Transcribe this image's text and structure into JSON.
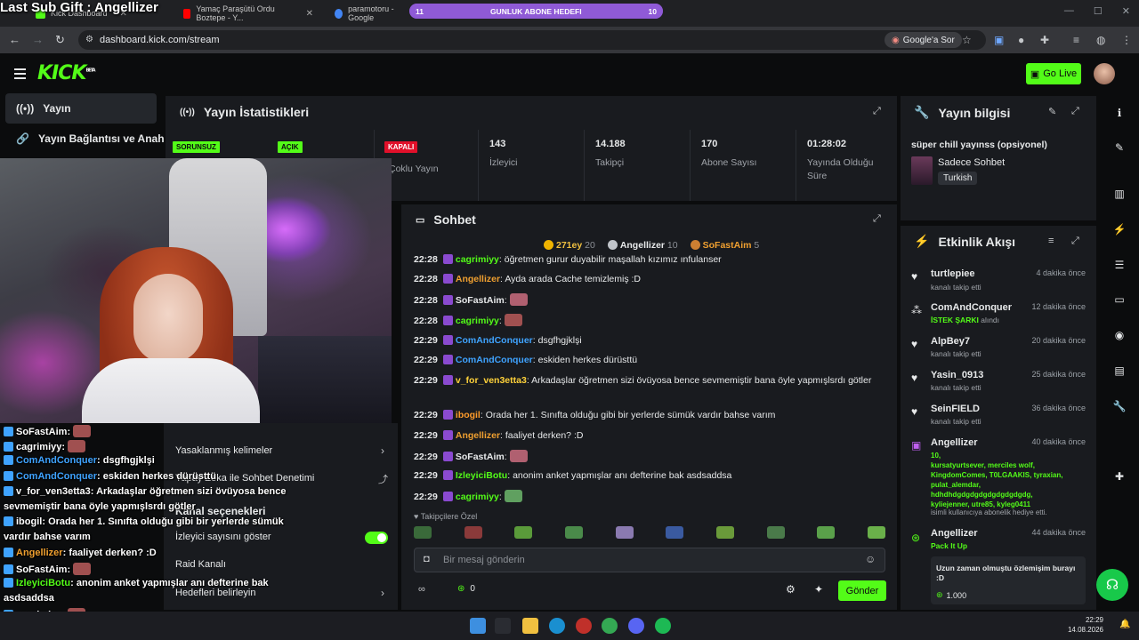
{
  "overlay_title": "Last Sub Gift : Angellizer",
  "browser": {
    "tabs": [
      {
        "label": "Kick Dashboard"
      },
      {
        "label": "Yamaç Paraşütü Ordu Boztepe - Y..."
      },
      {
        "label": "paramotoru - Google"
      }
    ],
    "url": "dashboard.kick.com/stream",
    "google_pill": "Google'a Sor"
  },
  "goal": {
    "start": "11",
    "label": "GUNLUK ABONE HEDEFI",
    "end": "10",
    "progress": 1.0
  },
  "header": {
    "logo": "KICK",
    "logo_beta": "BETA",
    "golive_label": "Go Live"
  },
  "sidebar": {
    "items": [
      {
        "label": "Yayın"
      },
      {
        "label": "Yayın Bağlantısı ve Anahtar"
      }
    ]
  },
  "stats": {
    "title": "Yayın İstatistikleri",
    "badges": [
      "SORUNSUZ",
      "AÇIK",
      "KAPALI"
    ],
    "badge3_label": "Çoklu Yayın",
    "cells": [
      {
        "value": "143",
        "label": "İzleyici"
      },
      {
        "value": "14.188",
        "label": "Takipçi"
      },
      {
        "value": "170",
        "label": "Abone Sayısı"
      },
      {
        "value": "01:28:02",
        "label": "Yayında Olduğu Süre"
      }
    ]
  },
  "stream_info": {
    "title": "Yayın bilgisi",
    "stream_title": "süper chill yayınss (opsiyonel)",
    "category": "Sadece Sohbet",
    "language": "Turkish"
  },
  "chat": {
    "title": "Sohbet",
    "leaders": [
      {
        "rank": "1",
        "name": "271ey",
        "count": "20"
      },
      {
        "rank": "2",
        "name": "Angellizer",
        "count": "10"
      },
      {
        "rank": "3",
        "name": "SoFastAim",
        "count": "5"
      }
    ],
    "messages": [
      {
        "time": "22:28",
        "user": "cagrimiyy",
        "text": "öğretmen gurur duyabilir maşallah kızımız ınfulanser",
        "color": "#53fc18"
      },
      {
        "time": "22:28",
        "user": "Angellizer",
        "text": "Ayda arada Cache temizlemiş :D",
        "color": "#f0a030"
      },
      {
        "time": "22:28",
        "user": "SoFastAim",
        "text": "",
        "color": "#e7e9ea"
      },
      {
        "time": "22:28",
        "user": "cagrimiyy",
        "text": "",
        "color": "#53fc18"
      },
      {
        "time": "22:29",
        "user": "ComAndConquer",
        "text": "dsgfhgjklşi",
        "color": "#3fa3ff"
      },
      {
        "time": "22:29",
        "user": "ComAndConquer",
        "text": "eskiden herkes dürüsttü",
        "color": "#3fa3ff"
      },
      {
        "time": "22:29",
        "user": "v_for_ven3etta3",
        "text": "Arkadaşlar öğretmen sizi övüyosa bence sevmemiştir bana öyle yapmışlsrdı götler",
        "color": "#ffd23a"
      },
      {
        "time": "22:29",
        "user": "ibogil",
        "text": "Orada her 1. Sınıfta olduğu gibi bir yerlerde sümük vardır bahse varım",
        "color": "#ff9c2a"
      },
      {
        "time": "22:29",
        "user": "Angellizer",
        "text": "faaliyet derken? :D",
        "color": "#f0a030"
      },
      {
        "time": "22:29",
        "user": "SoFastAim",
        "text": "",
        "color": "#e7e9ea"
      },
      {
        "time": "22:29",
        "user": "IzleyiciBotu",
        "text": "anonim anket yapmışlar anı defterine bak asdsaddsa",
        "color": "#53fc18"
      },
      {
        "time": "22:29",
        "user": "cagrimiyy",
        "text": "",
        "color": "#53fc18"
      }
    ],
    "followers_only": "Takipçilere Özel",
    "input_placeholder": "Bir mesaj gönderin",
    "points": "0",
    "send_label": "Gönder"
  },
  "events": {
    "title": "Etkinlik Akışı",
    "items": [
      {
        "name": "turtlepiee",
        "time": "4 dakika önce",
        "sub": "kanalı takip etti"
      },
      {
        "name": "ComAndConquer",
        "time": "12 dakika önce",
        "sub_highlight": "İSTEK ŞARKI",
        "sub": "alındı"
      },
      {
        "name": "AlpBey7",
        "time": "20 dakika önce",
        "sub": "kanalı takip etti"
      },
      {
        "name": "Yasin_0913",
        "time": "25 dakika önce",
        "sub": "kanalı takip etti"
      },
      {
        "name": "SeinFIELD",
        "time": "36 dakika önce",
        "sub": "kanalı takip etti"
      },
      {
        "name": "Angellizer",
        "time": "40 dakika önce",
        "gift_count": "10,",
        "gift_lines": [
          "kursatyurtsever, merciles wolf,",
          "KingdomComes, T0LGAAKIS, tyraxian,",
          "pulat_alemdar,",
          "hdhdhdgdgdgdgdgdgdgdgdg,",
          "kyliejenner, utre85, kyleg0411"
        ],
        "sub": "isimli kullanıcıya abonelik hediye etti."
      },
      {
        "name": "Angellizer",
        "time": "44 dakika önce",
        "sub_highlight": "Pack It Up",
        "message": "Uzun zaman olmuştu özlemişim burayı :D",
        "amount": "1.000"
      }
    ]
  },
  "overlay_chat": [
    {
      "user": "SoFastAim",
      "text": "",
      "color": "#ffffff"
    },
    {
      "user": "cagrimiyy",
      "text": "",
      "color": "#ffffff"
    },
    {
      "user": "ComAndConquer",
      "text": "dsgfhgjklşi",
      "color": "#3fa3ff"
    },
    {
      "user": "ComAndConquer",
      "text": "eskiden herkes dürüsttü",
      "color": "#3fa3ff"
    },
    {
      "user": "v_for_ven3etta3",
      "text": "Arkadaşlar öğretmen sizi övüyosa bence",
      "color": "#ffffff"
    },
    {
      "user": "",
      "text": "sevmemiştir bana öyle yapmışlsrdı götler",
      "color": "#ffffff"
    },
    {
      "user": "ibogil",
      "text": "Orada her 1. Sınıfta olduğu gibi bir yerlerde sümük",
      "color": "#ffffff"
    },
    {
      "user": "",
      "text": "vardır bahse varım",
      "color": "#ffffff"
    },
    {
      "user": "Angellizer",
      "text": "faaliyet derken? :D",
      "color": "#f0a030"
    },
    {
      "user": "SoFastAim",
      "text": "",
      "color": "#ffffff"
    },
    {
      "user": "IzleyiciBotu",
      "text": "anonim anket yapmışlar anı defterine bak",
      "color": "#53fc18"
    },
    {
      "user": "",
      "text": "asdsaddsa",
      "color": "#ffffff"
    },
    {
      "user": "cagrimiyy",
      "text": "",
      "color": "#ffffff"
    }
  ],
  "mod_settings": {
    "banned_words": "Yasaklanmış kelimeler",
    "ai_moderation": "Yapay Zeka ile Sohbet Denetimi",
    "channel_options": "Kanal seçenekleri",
    "show_viewers": "İzleyici sayısını göster",
    "raid": "Raid Kanalı",
    "goals": "Hedefleri belirleyin"
  },
  "taskbar": {
    "time": "22:29",
    "date": "14.08.2026"
  },
  "colors": {
    "accent": "#53fc18",
    "panel": "#191b1f",
    "bg": "#0b0c0d"
  }
}
